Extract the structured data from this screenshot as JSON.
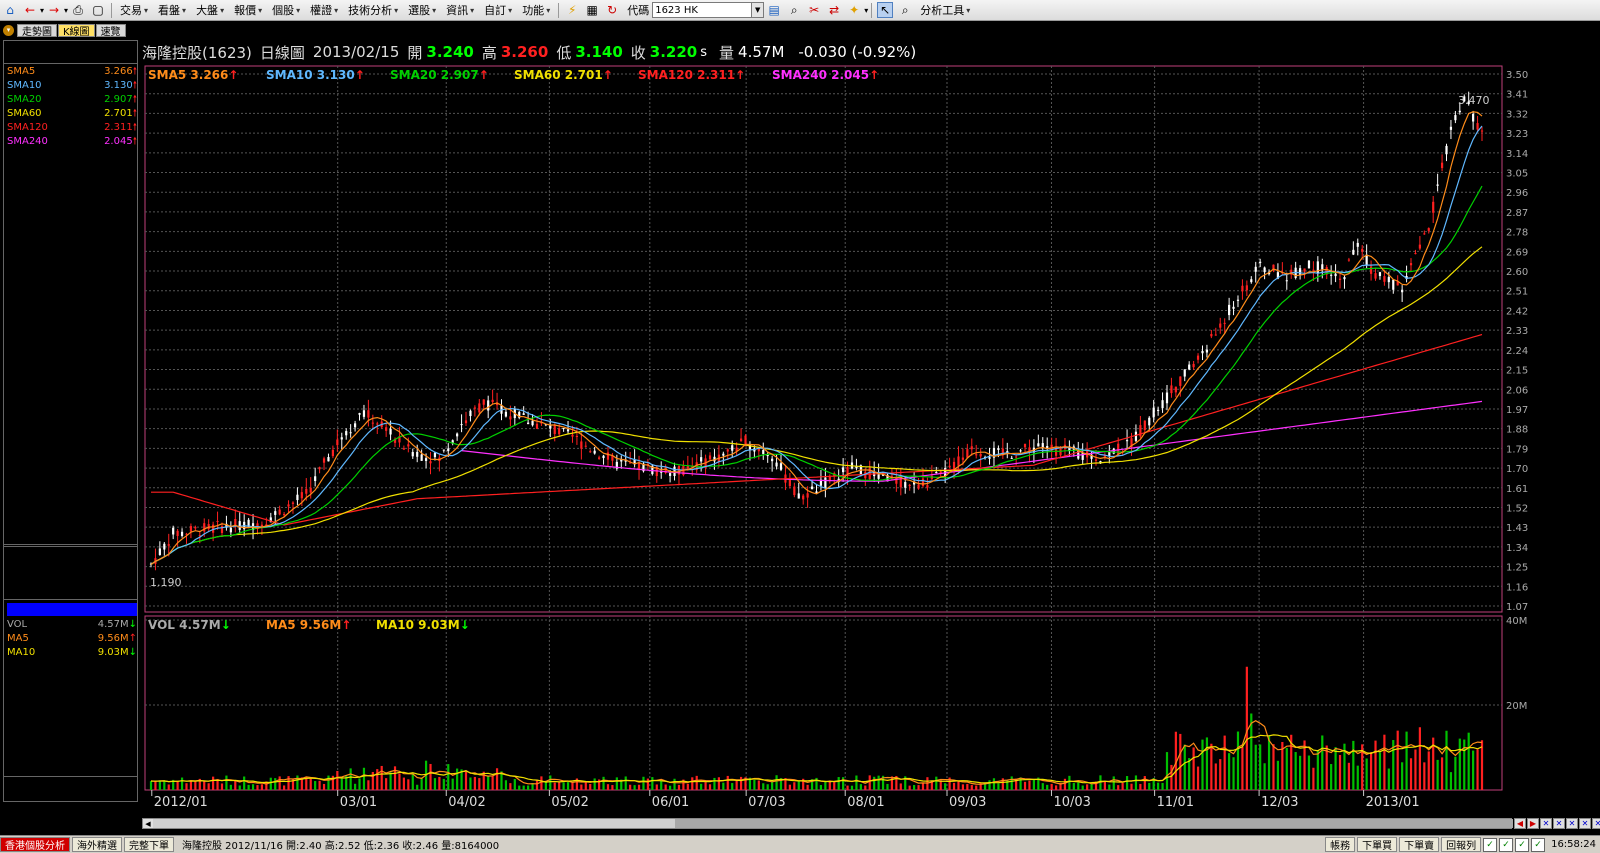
{
  "toolbar": {
    "menus": [
      "交易",
      "看盤",
      "大盤",
      "報價",
      "個股",
      "權證",
      "技術分析",
      "選股",
      "資訊",
      "自訂",
      "功能"
    ],
    "code_label": "代碼",
    "code_value": "1623 HK",
    "analysis_tools": "分析工具"
  },
  "view_tabs": [
    "走勢圖",
    "K線圖",
    "速覽"
  ],
  "quote": {
    "name": "海隆控股(1623)",
    "period": "日線圖",
    "date": "2013/02/15",
    "open_label": "開",
    "open": "3.240",
    "high_label": "高",
    "high": "3.260",
    "low_label": "低",
    "low": "3.140",
    "close_label": "收",
    "close": "3.220",
    "close_suffix": "s",
    "volume_label": "量",
    "volume": "4.57M",
    "change": "-0.030 (-0.92%)"
  },
  "ma_legend": [
    {
      "name": "SMA5",
      "value": "3.266",
      "color": "#ff8c1a"
    },
    {
      "name": "SMA10",
      "value": "3.130",
      "color": "#5fb8ff"
    },
    {
      "name": "SMA20",
      "value": "2.907",
      "color": "#00d000"
    },
    {
      "name": "SMA60",
      "value": "2.701",
      "color": "#f0e000"
    },
    {
      "name": "SMA120",
      "value": "2.311",
      "color": "#ff2020"
    },
    {
      "name": "SMA240",
      "value": "2.045",
      "color": "#ff30ff"
    }
  ],
  "vol_legend": [
    {
      "name": "VOL",
      "value": "4.57M",
      "color": "#aaaaaa"
    },
    {
      "name": "MA5",
      "value": "9.56M",
      "color": "#ff8c1a"
    },
    {
      "name": "MA10",
      "value": "9.03M",
      "color": "#f0e000"
    }
  ],
  "price_axis": [
    "3.50",
    "3.41",
    "3.32",
    "3.23",
    "3.14",
    "3.05",
    "2.96",
    "2.87",
    "2.78",
    "2.69",
    "2.60",
    "2.51",
    "2.42",
    "2.33",
    "2.24",
    "2.15",
    "2.06",
    "1.97",
    "1.88",
    "1.79",
    "1.70",
    "1.61",
    "1.52",
    "1.43",
    "1.34",
    "1.25",
    "1.16",
    "1.07"
  ],
  "vol_axis": [
    "40M",
    "20M"
  ],
  "date_axis": [
    "2012/01",
    "03/01",
    "04/02",
    "05/02",
    "06/01",
    "07/03",
    "08/01",
    "09/03",
    "10/03",
    "11/01",
    "12/03",
    "2013/01"
  ],
  "labels": {
    "high_mark": "3.470",
    "low_mark": "1.190"
  },
  "status": {
    "tab_active": "香港個股分析",
    "tab2": "海外精選",
    "tab3": "完整下單",
    "ticker": "海隆控股 2012/11/16 開:2.40 高:2.52 低:2.36 收:2.46 量:8164000",
    "btn_account": "帳務",
    "btn_order_buy": "下單買",
    "btn_order_sell": "下單賣",
    "btn_return": "回報列",
    "clock": "16:58:24"
  },
  "chart_data": {
    "type": "candlestick",
    "ylim": [
      1.07,
      3.5
    ],
    "vol_ylim": [
      0,
      40
    ],
    "vol_unit": "M",
    "series_names": [
      "SMA5",
      "SMA10",
      "SMA20",
      "SMA60",
      "SMA120",
      "SMA240",
      "VOL",
      "MA5",
      "MA10"
    ],
    "last_values": {
      "SMA5": 3.266,
      "SMA10": 3.13,
      "SMA20": 2.907,
      "SMA60": 2.701,
      "SMA120": 2.311,
      "SMA240": 2.045,
      "VOL_MA5": 9.56,
      "VOL_MA10": 9.03
    }
  }
}
